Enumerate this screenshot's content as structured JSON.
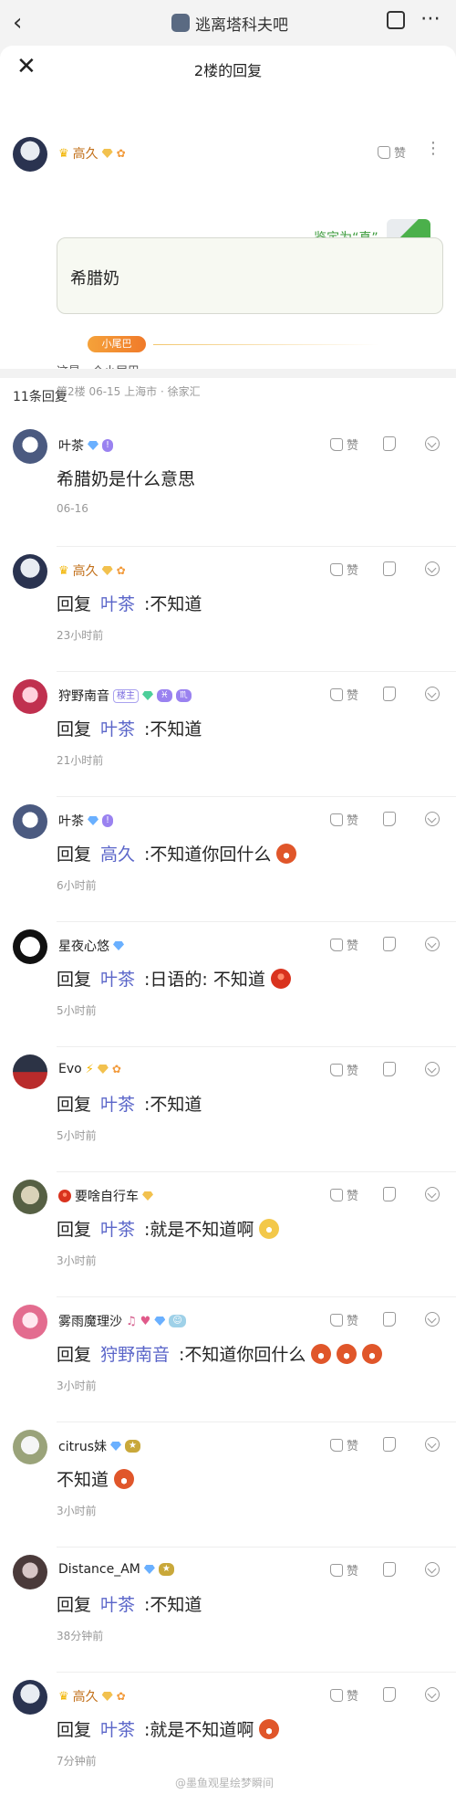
{
  "topbar": {
    "forum_name": "逃离塔科夫吧"
  },
  "sheet": {
    "title": "2楼的回复"
  },
  "post": {
    "user": "高久",
    "like_label": "赞",
    "verify_text": "鉴定为“真”...",
    "quote_text": "希腊奶",
    "tail_badge": "小尾巴",
    "tail_text": "这是一个小尾巴",
    "meta": "第2楼  06-15  上海市 · 徐家汇"
  },
  "replies_count": "11条回复",
  "replies": [
    {
      "user": "叶茶",
      "badge": "",
      "content_prefix": "希腊奶是什么意思",
      "mention": "",
      "content_suffix": "",
      "time": "06-16",
      "like": "赞"
    },
    {
      "user": "高久",
      "badge": "",
      "content_prefix": "回复",
      "mention": "叶茶",
      "content_suffix": ":不知道",
      "time": "23小时前",
      "like": "赞"
    },
    {
      "user": "狩野南音",
      "badge": "楼主",
      "content_prefix": "回复",
      "mention": "叶茶",
      "content_suffix": ":不知道",
      "time": "21小时前",
      "like": "赞"
    },
    {
      "user": "叶茶",
      "badge": "",
      "content_prefix": "回复",
      "mention": "高久",
      "content_suffix": ":不知道你回什么",
      "time": "6小时前",
      "like": "赞"
    },
    {
      "user": "星夜心悠",
      "badge": "",
      "content_prefix": "回复",
      "mention": "叶茶",
      "content_suffix": ":日语的: 不知道",
      "time": "5小时前",
      "like": "赞"
    },
    {
      "user": "Evo",
      "badge": "",
      "content_prefix": "回复",
      "mention": "叶茶",
      "content_suffix": ":不知道",
      "time": "5小时前",
      "like": "赞"
    },
    {
      "user": "要啥自行车",
      "badge": "",
      "content_prefix": "回复",
      "mention": "叶茶",
      "content_suffix": ":就是不知道啊",
      "time": "3小时前",
      "like": "赞"
    },
    {
      "user": "雾雨魔理沙",
      "badge": "",
      "content_prefix": "回复",
      "mention": "狩野南音",
      "content_suffix": ":不知道你回什么",
      "time": "3小时前",
      "like": "赞"
    },
    {
      "user": "citrus妹",
      "badge": "",
      "content_prefix": "不知道",
      "mention": "",
      "content_suffix": "",
      "time": "3小时前",
      "like": "赞"
    },
    {
      "user": "Distance_AM",
      "badge": "",
      "content_prefix": "回复",
      "mention": "叶茶",
      "content_suffix": ":不知道",
      "time": "38分钟前",
      "like": "赞"
    },
    {
      "user": "高久",
      "badge": "",
      "content_prefix": "回复",
      "mention": "叶茶",
      "content_suffix": ":就是不知道啊",
      "time": "7分钟前",
      "like": "赞"
    }
  ],
  "watermark": "@墨鱼观星绘梦瞬间"
}
